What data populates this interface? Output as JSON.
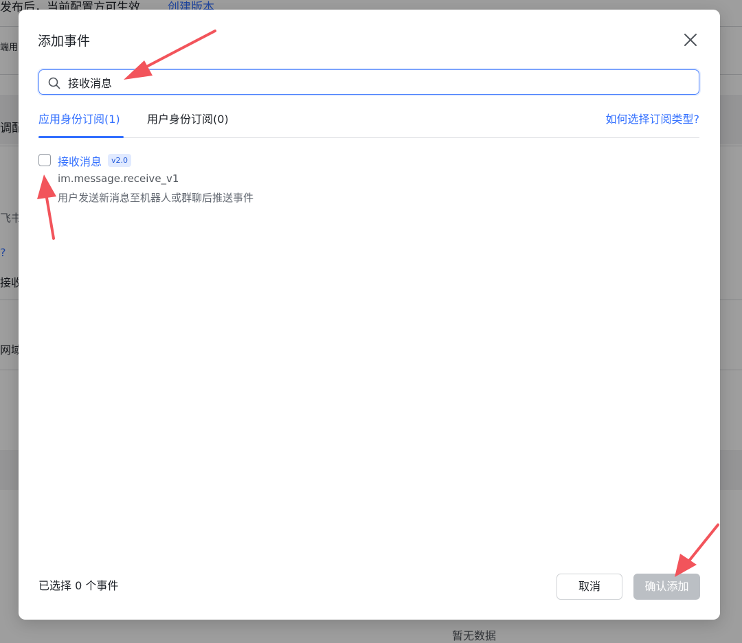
{
  "background": {
    "top_text": "发布后，当前配置方可生效",
    "top_link": "创建版本",
    "row1_text": "端用",
    "row2_text": "调配",
    "row3_text": "飞书",
    "row4_text": "?",
    "row5_text": "接收事",
    "row6_text": "网域",
    "empty_text": "暂无数据"
  },
  "modal": {
    "title": "添加事件",
    "close_icon": "close-icon"
  },
  "search": {
    "icon": "search-icon",
    "value": "接收消息"
  },
  "tabs": [
    {
      "label": "应用身份订阅(1)",
      "active": true
    },
    {
      "label": "用户身份订阅(0)",
      "active": false
    }
  ],
  "help_link": "如何选择订阅类型?",
  "events": [
    {
      "name": "接收消息",
      "version": "v2.0",
      "key": "im.message.receive_v1",
      "description": "用户发送新消息至机器人或群聊后推送事件",
      "checked": false
    }
  ],
  "footer": {
    "selected_text": "已选择 0 个事件",
    "cancel_label": "取消",
    "confirm_label": "确认添加"
  },
  "colors": {
    "accent": "#3370ff",
    "annotation_arrow": "#f2545b",
    "disabled_button": "#bbbfc4"
  }
}
